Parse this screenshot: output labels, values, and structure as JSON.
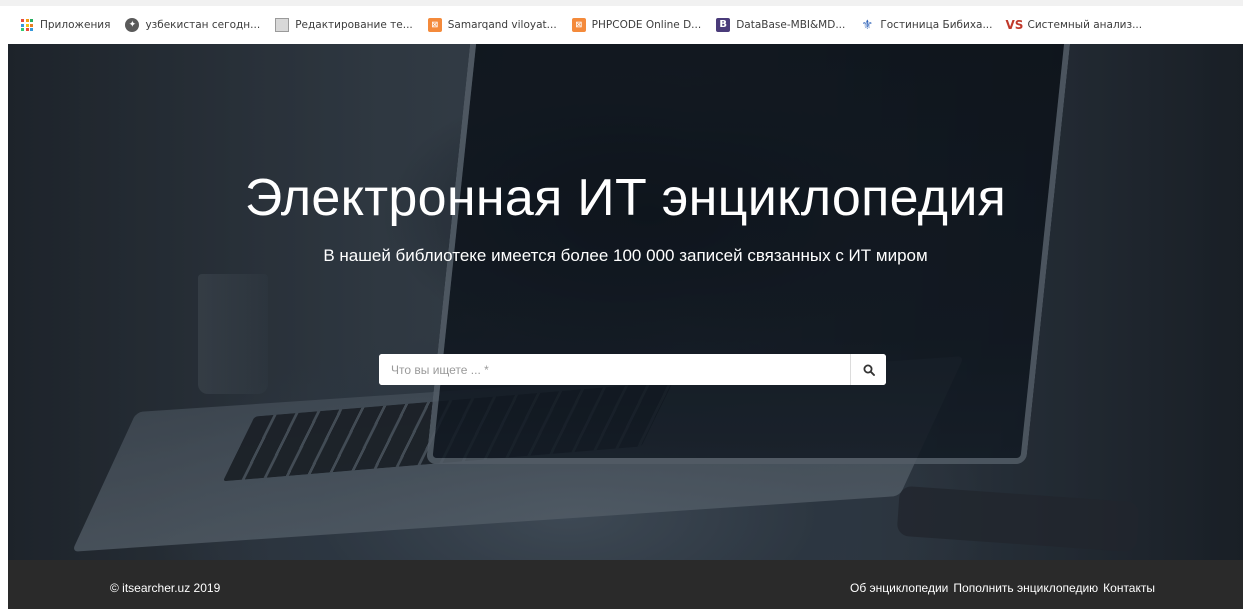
{
  "bookmarks": [
    {
      "label": "Приложения",
      "icon": "apps-grid-icon"
    },
    {
      "label": "узбекистан сегодн...",
      "icon": "globe-icon"
    },
    {
      "label": "Редактирование те...",
      "icon": "document-icon"
    },
    {
      "label": "Samarqand viloyat...",
      "icon": "orange-square-icon"
    },
    {
      "label": "PHPCODE Online D...",
      "icon": "orange-square-icon"
    },
    {
      "label": "DataBase-MBI&MD...",
      "icon": "b-logo-icon",
      "icon_text": "B"
    },
    {
      "label": "Гостиница Бибиха...",
      "icon": "hotel-icon"
    },
    {
      "label": "Системный анализ...",
      "icon": "vs-logo-icon",
      "icon_text": "VS"
    }
  ],
  "hero": {
    "title": "Электронная ИТ энциклопедия",
    "subtitle": "В нашей библиотеке имеется более 100 000 записей связанных с ИТ миром"
  },
  "search": {
    "placeholder": "Что вы ищете ... *",
    "value": "",
    "button_icon": "search-icon"
  },
  "footer": {
    "copyright": "© itsearcher.uz 2019",
    "links": [
      "Об энциклопедии",
      "Пополнить энциклопедию",
      "Контакты"
    ],
    "background": "#2a2a2a"
  },
  "colors": {
    "apps_grid": [
      "#e74c3c",
      "#f39c12",
      "#27ae60",
      "#3498db",
      "#f1c40f",
      "#e67e22",
      "#2ecc71",
      "#e74c3c",
      "#3498db"
    ],
    "bookmark_orange": "#f48a3b",
    "bookmark_b": "#4a3b7a",
    "bookmark_vs": "#c0392b"
  }
}
